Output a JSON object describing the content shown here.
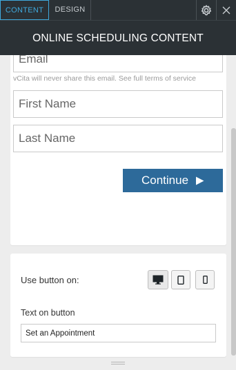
{
  "tabs": [
    {
      "label": "CONTENT",
      "active": true
    },
    {
      "label": "DESIGN",
      "active": false
    }
  ],
  "toolbar_icons": {
    "settings": "gear-icon",
    "close": "close-icon"
  },
  "header": {
    "title": "ONLINE SCHEDULING CONTENT"
  },
  "form": {
    "email_placeholder": "Email",
    "privacy_text": "vCita will never share this email. See ",
    "privacy_link": "full terms of service",
    "first_name_placeholder": "First Name",
    "last_name_placeholder": "Last Name",
    "continue_label": "Continue",
    "continue_icon": "play-arrow-icon"
  },
  "settings": {
    "use_button_label": "Use button on:",
    "devices": [
      {
        "name": "desktop",
        "icon": "desktop-icon",
        "selected": true
      },
      {
        "name": "tablet",
        "icon": "tablet-icon",
        "selected": false
      },
      {
        "name": "mobile",
        "icon": "mobile-icon",
        "selected": false
      }
    ],
    "text_on_button_label": "Text on button",
    "text_on_button_value": "Set an Appointment"
  },
  "colors": {
    "toolbar_bg": "#2b3135",
    "active_tab": "#3fa9dd",
    "button_blue": "#2d6a9a",
    "panel_bg": "#ededed"
  }
}
